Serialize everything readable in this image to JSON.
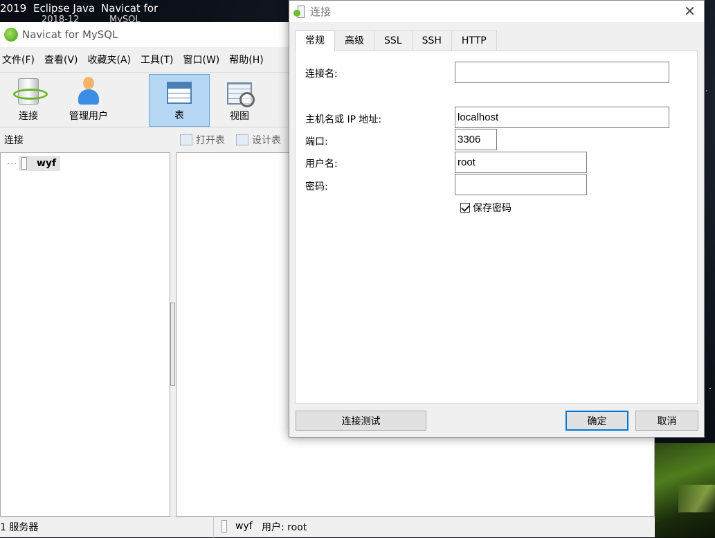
{
  "taskbar": {
    "items": [
      {
        "label": "2019",
        "sub": ""
      },
      {
        "label": "Eclipse Java",
        "sub": "2018-12"
      },
      {
        "label": "Navicat for",
        "sub": "MySQL"
      }
    ]
  },
  "navicat": {
    "title": "Navicat for MySQL",
    "menu": [
      "文件(F)",
      "查看(V)",
      "收藏夹(A)",
      "工具(T)",
      "窗口(W)",
      "帮助(H)"
    ],
    "toolbar": {
      "connect": "连接",
      "manage_users": "管理用户",
      "table": "表",
      "view": "视图"
    },
    "object_bar": {
      "label": "连接",
      "open_table": "打开表",
      "design_table": "设计表"
    },
    "tree": {
      "connection": "wyf"
    },
    "status": {
      "servers": "1 服务器",
      "db": "wyf",
      "user": "用户: root"
    }
  },
  "dialog": {
    "title": "连接",
    "close_glyph": "✕",
    "tabs": [
      "常规",
      "高级",
      "SSL",
      "SSH",
      "HTTP"
    ],
    "fields": {
      "conn_name_label": "连接名:",
      "conn_name_value": "",
      "host_label": "主机名或 IP 地址:",
      "host_value": "localhost",
      "port_label": "端口:",
      "port_value": "3306",
      "user_label": "用户名:",
      "user_value": "root",
      "password_label": "密码:",
      "password_value": ""
    },
    "save_password": {
      "label": "保存密码",
      "checked": true
    },
    "buttons": {
      "test": "连接测试",
      "ok": "确定",
      "cancel": "取消"
    }
  }
}
